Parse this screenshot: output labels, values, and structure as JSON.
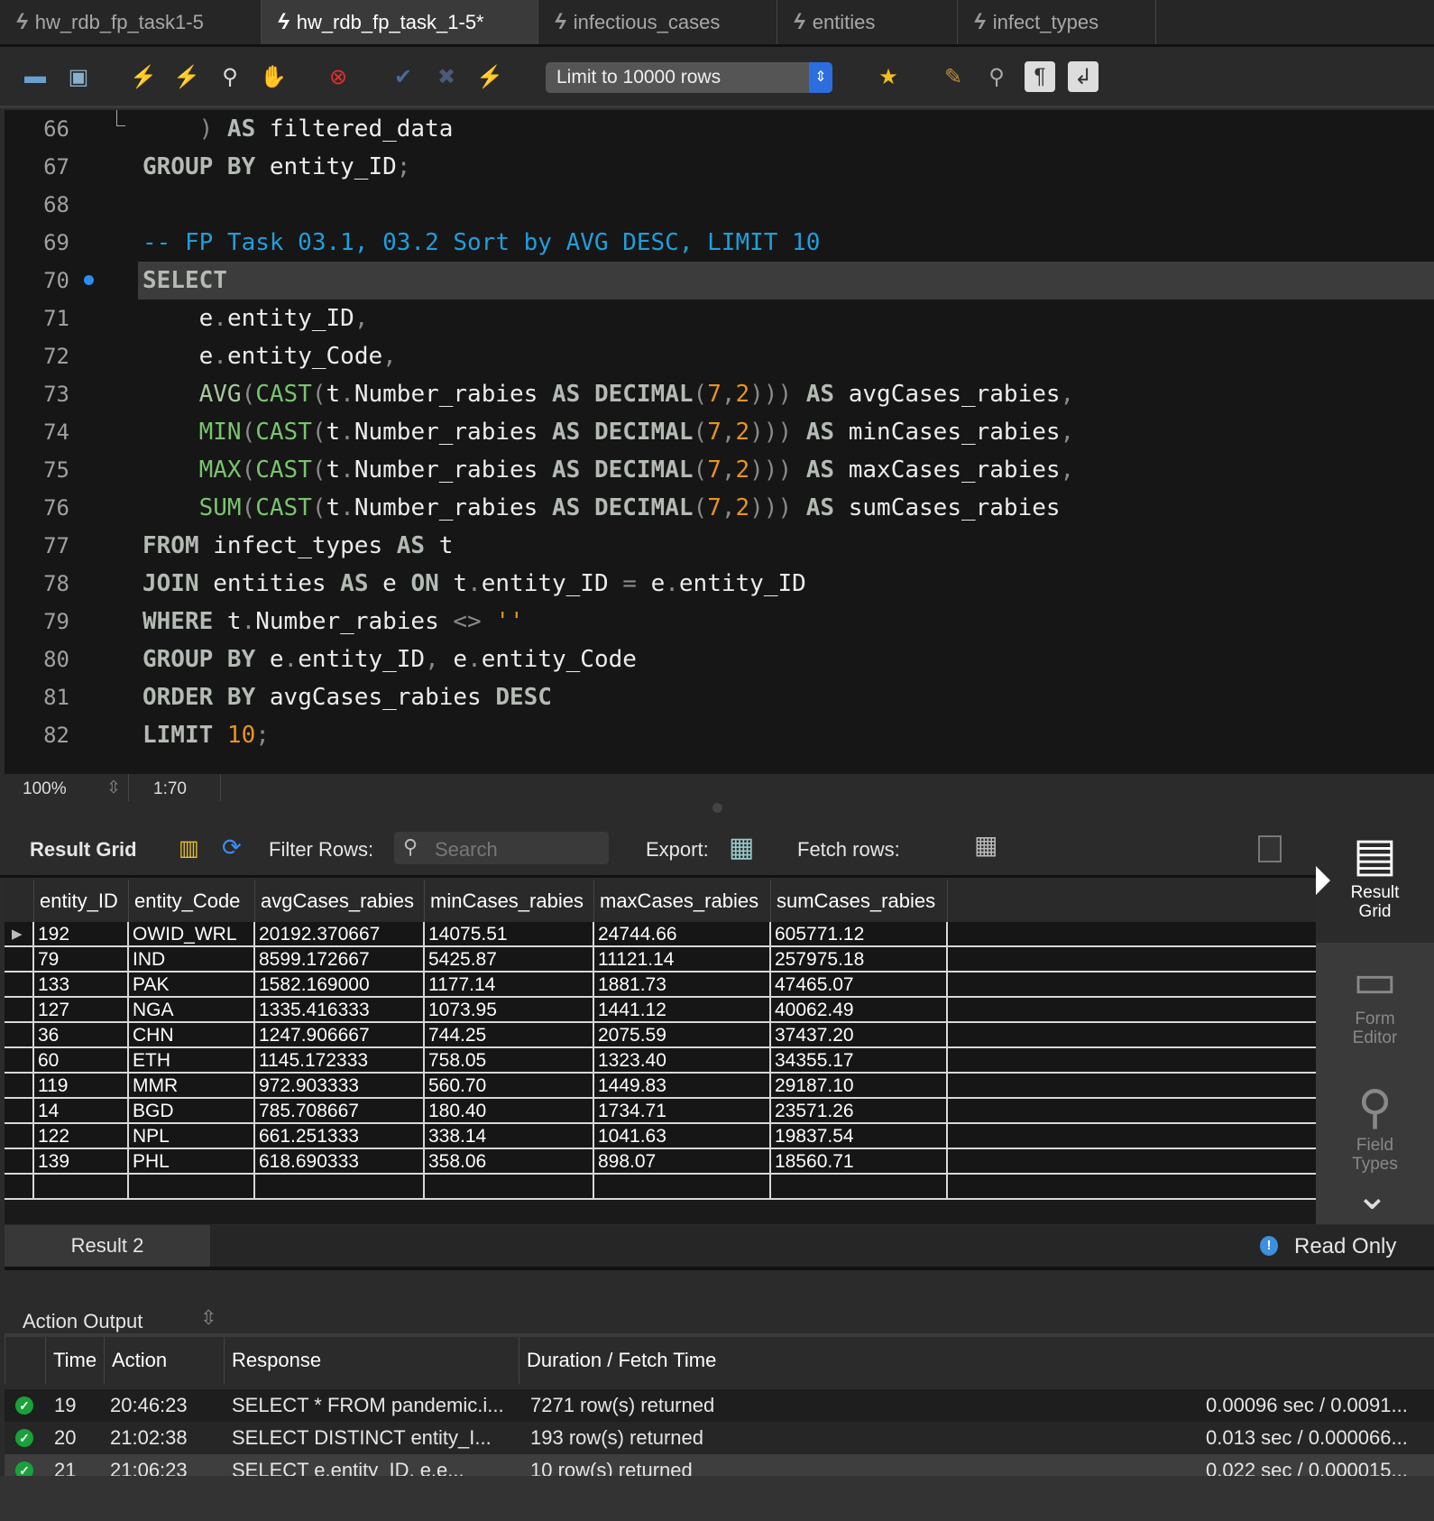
{
  "tabs": [
    {
      "label": "hw_rdb_fp_task1-5",
      "active": false
    },
    {
      "label": "hw_rdb_fp_task_1-5*",
      "active": true
    },
    {
      "label": "infectious_cases",
      "active": false
    },
    {
      "label": "entities",
      "active": false
    },
    {
      "label": "infect_types",
      "active": false
    }
  ],
  "toolbar": {
    "limit_select": "Limit to 10000 rows",
    "icons": [
      "open-folder-icon",
      "save-icon",
      "execute-icon",
      "execute-current-icon",
      "explain-icon",
      "stop-icon",
      "stop-on-error-icon",
      "commit-icon",
      "rollback-icon",
      "autocommit-icon",
      "bookmark-icon",
      "beautify-icon",
      "find-icon",
      "invisible-chars-icon",
      "wrap-icon"
    ]
  },
  "editor": {
    "current_line": "70",
    "lines": [
      {
        "n": "66",
        "t": [
          [
            "pu",
            "    ) "
          ],
          [
            "kw",
            "AS"
          ],
          [
            "id",
            " filtered_data"
          ]
        ]
      },
      {
        "n": "67",
        "t": [
          [
            "kw",
            "GROUP BY"
          ],
          [
            "id",
            " entity_ID"
          ],
          [
            "pu",
            ";"
          ]
        ]
      },
      {
        "n": "68",
        "t": []
      },
      {
        "n": "69",
        "t": [
          [
            "cm",
            "-- FP Task 03.1, 03.2 Sort by AVG DESC, LIMIT 10"
          ]
        ]
      },
      {
        "n": "70",
        "t": [
          [
            "kw",
            "SELECT"
          ]
        ]
      },
      {
        "n": "71",
        "t": [
          [
            "id",
            "    e"
          ],
          [
            "pu",
            "."
          ],
          [
            "id",
            "entity_ID"
          ],
          [
            "pu",
            ","
          ]
        ]
      },
      {
        "n": "72",
        "t": [
          [
            "id",
            "    e"
          ],
          [
            "pu",
            "."
          ],
          [
            "id",
            "entity_Code"
          ],
          [
            "pu",
            ","
          ]
        ]
      },
      {
        "n": "73",
        "t": [
          [
            "fn",
            "    AVG"
          ],
          [
            "pu",
            "("
          ],
          [
            "fg",
            "CAST"
          ],
          [
            "pu",
            "("
          ],
          [
            "id",
            "t"
          ],
          [
            "pu",
            "."
          ],
          [
            "id",
            "Number_rabies "
          ],
          [
            "kw",
            "AS DECIMAL"
          ],
          [
            "pu",
            "("
          ],
          [
            "nu",
            "7"
          ],
          [
            "pu",
            ","
          ],
          [
            "nu",
            "2"
          ],
          [
            "pu",
            ")))"
          ],
          [
            "kw",
            " AS"
          ],
          [
            "id",
            " avgCases_rabies"
          ],
          [
            "pu",
            ","
          ]
        ]
      },
      {
        "n": "74",
        "t": [
          [
            "fg",
            "    MIN"
          ],
          [
            "pu",
            "("
          ],
          [
            "fg",
            "CAST"
          ],
          [
            "pu",
            "("
          ],
          [
            "id",
            "t"
          ],
          [
            "pu",
            "."
          ],
          [
            "id",
            "Number_rabies "
          ],
          [
            "kw",
            "AS DECIMAL"
          ],
          [
            "pu",
            "("
          ],
          [
            "nu",
            "7"
          ],
          [
            "pu",
            ","
          ],
          [
            "nu",
            "2"
          ],
          [
            "pu",
            ")))"
          ],
          [
            "kw",
            " AS"
          ],
          [
            "id",
            " minCases_rabies"
          ],
          [
            "pu",
            ","
          ]
        ]
      },
      {
        "n": "75",
        "t": [
          [
            "fg",
            "    MAX"
          ],
          [
            "pu",
            "("
          ],
          [
            "fg",
            "CAST"
          ],
          [
            "pu",
            "("
          ],
          [
            "id",
            "t"
          ],
          [
            "pu",
            "."
          ],
          [
            "id",
            "Number_rabies "
          ],
          [
            "kw",
            "AS DECIMAL"
          ],
          [
            "pu",
            "("
          ],
          [
            "nu",
            "7"
          ],
          [
            "pu",
            ","
          ],
          [
            "nu",
            "2"
          ],
          [
            "pu",
            ")))"
          ],
          [
            "kw",
            " AS"
          ],
          [
            "id",
            " maxCases_rabies"
          ],
          [
            "pu",
            ","
          ]
        ]
      },
      {
        "n": "76",
        "t": [
          [
            "fg",
            "    SUM"
          ],
          [
            "pu",
            "("
          ],
          [
            "fg",
            "CAST"
          ],
          [
            "pu",
            "("
          ],
          [
            "id",
            "t"
          ],
          [
            "pu",
            "."
          ],
          [
            "id",
            "Number_rabies "
          ],
          [
            "kw",
            "AS DECIMAL"
          ],
          [
            "pu",
            "("
          ],
          [
            "nu",
            "7"
          ],
          [
            "pu",
            ","
          ],
          [
            "nu",
            "2"
          ],
          [
            "pu",
            ")))"
          ],
          [
            "kw",
            " AS"
          ],
          [
            "id",
            " sumCases_rabies"
          ]
        ]
      },
      {
        "n": "77",
        "t": [
          [
            "kw",
            "FROM"
          ],
          [
            "id",
            " infect_types "
          ],
          [
            "kw",
            "AS"
          ],
          [
            "id",
            " t"
          ]
        ]
      },
      {
        "n": "78",
        "t": [
          [
            "kw",
            "JOIN"
          ],
          [
            "id",
            " entities "
          ],
          [
            "kw",
            "AS"
          ],
          [
            "id",
            " e "
          ],
          [
            "kw",
            "ON"
          ],
          [
            "id",
            " t"
          ],
          [
            "pu",
            "."
          ],
          [
            "id",
            "entity_ID "
          ],
          [
            "pu",
            "="
          ],
          [
            "id",
            " e"
          ],
          [
            "pu",
            "."
          ],
          [
            "id",
            "entity_ID"
          ]
        ]
      },
      {
        "n": "79",
        "t": [
          [
            "kw",
            "WHERE"
          ],
          [
            "id",
            " t"
          ],
          [
            "pu",
            "."
          ],
          [
            "id",
            "Number_rabies "
          ],
          [
            "pu",
            "<> "
          ],
          [
            "st",
            "''"
          ]
        ]
      },
      {
        "n": "80",
        "t": [
          [
            "kw",
            "GROUP BY"
          ],
          [
            "id",
            " e"
          ],
          [
            "pu",
            "."
          ],
          [
            "id",
            "entity_ID"
          ],
          [
            "pu",
            ","
          ],
          [
            "id",
            " e"
          ],
          [
            "pu",
            "."
          ],
          [
            "id",
            "entity_Code"
          ]
        ]
      },
      {
        "n": "81",
        "t": [
          [
            "kw",
            "ORDER BY"
          ],
          [
            "id",
            " avgCases_rabies "
          ],
          [
            "kw",
            "DESC"
          ]
        ]
      },
      {
        "n": "82",
        "t": [
          [
            "kw",
            "LIMIT"
          ],
          [
            "nu",
            " 10"
          ],
          [
            "pu",
            ";"
          ]
        ]
      }
    ]
  },
  "status": {
    "zoom": "100%",
    "position": "1:70"
  },
  "result_toolbar": {
    "title": "Result Grid",
    "filter_label": "Filter Rows:",
    "search_placeholder": "Search",
    "export_label": "Export:",
    "fetch_label": "Fetch rows:"
  },
  "grid": {
    "columns": [
      "entity_ID",
      "entity_Code",
      "avgCases_rabies",
      "minCases_rabies",
      "maxCases_rabies",
      "sumCases_rabies"
    ],
    "rows": [
      [
        "192",
        "OWID_WRL",
        "20192.370667",
        "14075.51",
        "24744.66",
        "605771.12"
      ],
      [
        "79",
        "IND",
        "8599.172667",
        "5425.87",
        "11121.14",
        "257975.18"
      ],
      [
        "133",
        "PAK",
        "1582.169000",
        "1177.14",
        "1881.73",
        "47465.07"
      ],
      [
        "127",
        "NGA",
        "1335.416333",
        "1073.95",
        "1441.12",
        "40062.49"
      ],
      [
        "36",
        "CHN",
        "1247.906667",
        "744.25",
        "2075.59",
        "37437.20"
      ],
      [
        "60",
        "ETH",
        "1145.172333",
        "758.05",
        "1323.40",
        "34355.17"
      ],
      [
        "119",
        "MMR",
        "972.903333",
        "560.70",
        "1449.83",
        "29187.10"
      ],
      [
        "14",
        "BGD",
        "785.708667",
        "180.40",
        "1734.71",
        "23571.26"
      ],
      [
        "122",
        "NPL",
        "661.251333",
        "338.14",
        "1041.63",
        "19837.54"
      ],
      [
        "139",
        "PHL",
        "618.690333",
        "358.06",
        "898.07",
        "18560.71"
      ]
    ]
  },
  "side_panel": [
    {
      "label": "Result Grid",
      "active": true
    },
    {
      "label": "Form Editor",
      "active": false
    },
    {
      "label": "Field Types",
      "active": false
    }
  ],
  "result_tabs": {
    "tab": "Result 2",
    "read_only": "Read Only"
  },
  "action_output": {
    "title": "Action Output",
    "columns": [
      "",
      "Time",
      "Action",
      "Response",
      "Duration / Fetch Time"
    ],
    "rows": [
      {
        "n": "19",
        "time": "20:46:23",
        "action": "SELECT * FROM pandemic.i...",
        "response": "7271 row(s) returned",
        "duration": "0.00096 sec / 0.0091...",
        "status": "success"
      },
      {
        "n": "20",
        "time": "21:02:38",
        "action": "SELECT    DISTINCT entity_I...",
        "response": "193 row(s) returned",
        "duration": "0.013 sec / 0.000066...",
        "status": "success"
      },
      {
        "n": "21",
        "time": "21:06:23",
        "action": "SELECT    e.entity_ID,    e.e...",
        "response": "10 row(s) returned",
        "duration": "0.022 sec / 0.000015...",
        "status": "success"
      }
    ]
  }
}
